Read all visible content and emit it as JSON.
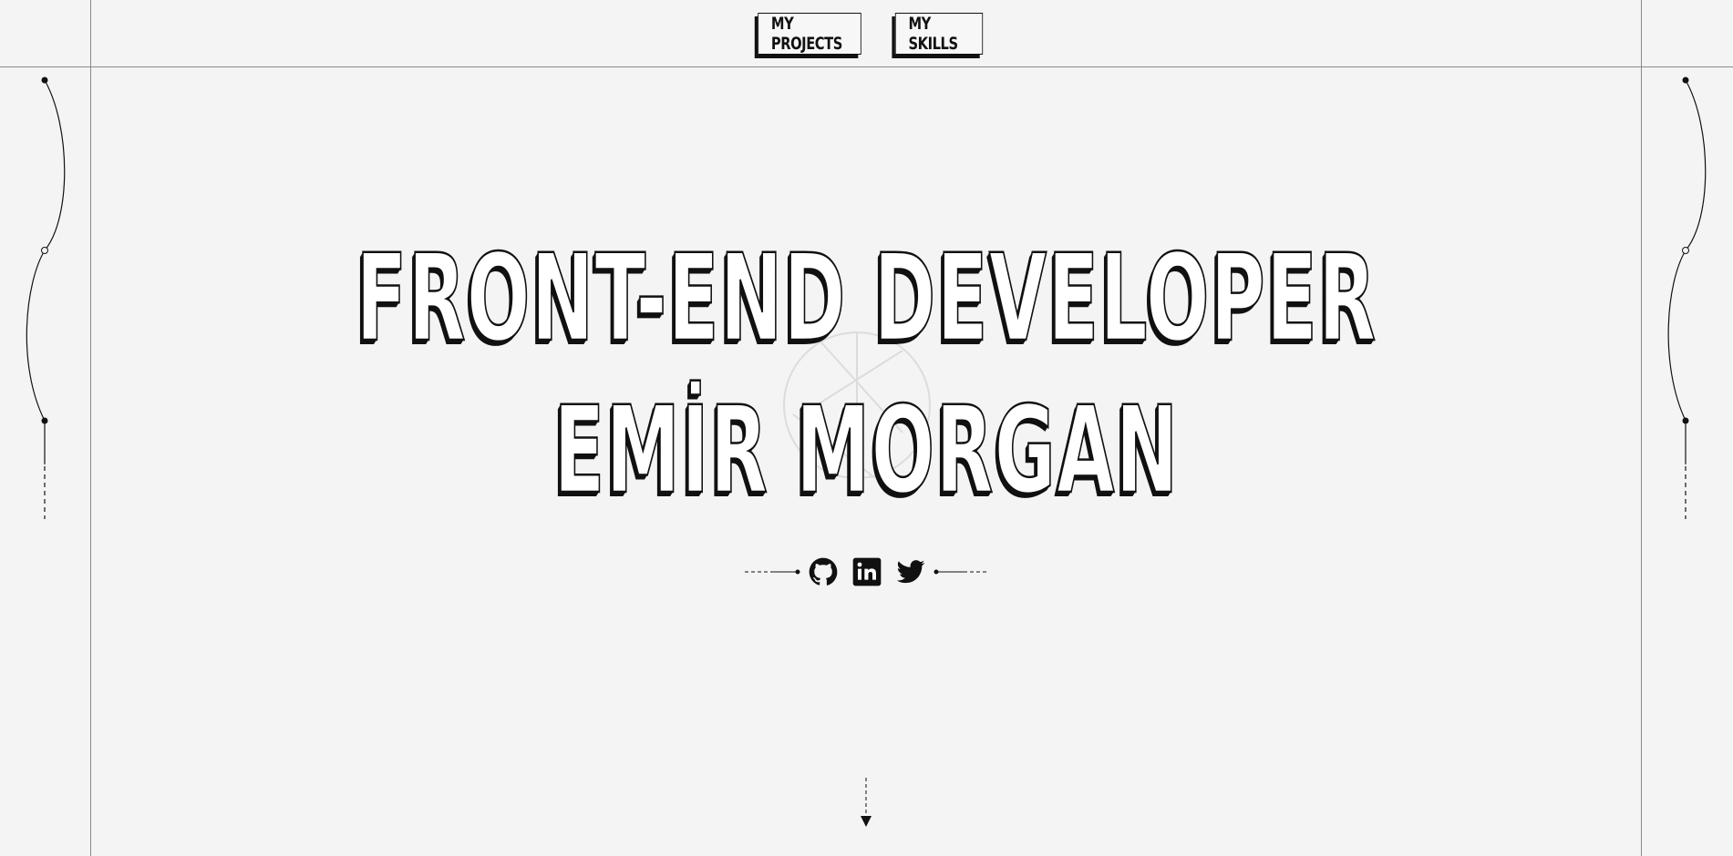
{
  "nav": {
    "items": [
      {
        "label": "MY PROJECTS"
      },
      {
        "label": "MY SKILLS"
      }
    ]
  },
  "hero": {
    "title": "FRONT-END DEVELOPER",
    "name": "EMİR MORGAN"
  },
  "social": {
    "icons": [
      "github-icon",
      "linkedin-icon",
      "twitter-icon"
    ]
  },
  "colors": {
    "background": "#f4f4f4",
    "ink": "#111111",
    "frame": "#8a8a8a"
  }
}
